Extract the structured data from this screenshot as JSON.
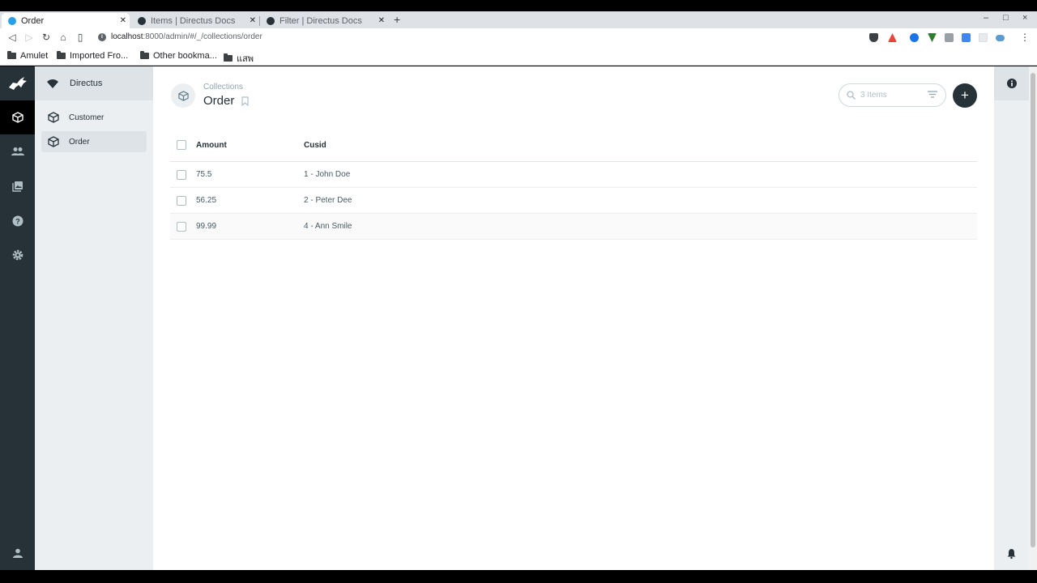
{
  "browser": {
    "tabs": [
      {
        "title": "Order",
        "favicon_color": "#26a0e8"
      },
      {
        "title": "Items | Directus Docs",
        "favicon_color": "#263238"
      },
      {
        "title": "Filter | Directus Docs",
        "favicon_color": "#263238"
      }
    ],
    "new_tab": "+",
    "url_host": "localhost",
    "url_path": ":8000/admin/#/_/collections/order",
    "bookmarks": [
      "Amulet",
      "Imported Fro...",
      "Other bookma...",
      "แสพ"
    ],
    "window_controls": [
      "–",
      "□",
      "×"
    ]
  },
  "project": {
    "name": "Directus"
  },
  "sidebar": {
    "items": [
      {
        "label": "Customer",
        "active": false
      },
      {
        "label": "Order",
        "active": true
      }
    ]
  },
  "header": {
    "breadcrumb": "Collections",
    "title": "Order"
  },
  "search": {
    "placeholder": "3 Items"
  },
  "add_button": {
    "label": "+"
  },
  "table": {
    "columns": [
      "Amount",
      "Cusid"
    ],
    "rows": [
      {
        "amount": "75.5",
        "cusid": "1 - John Doe"
      },
      {
        "amount": "56.25",
        "cusid": "2 - Peter Dee"
      },
      {
        "amount": "99.99",
        "cusid": "4 - Ann Smile"
      }
    ]
  },
  "colors": {
    "rail": "#263238",
    "nav": "#eceff1",
    "accent": "#263238"
  }
}
